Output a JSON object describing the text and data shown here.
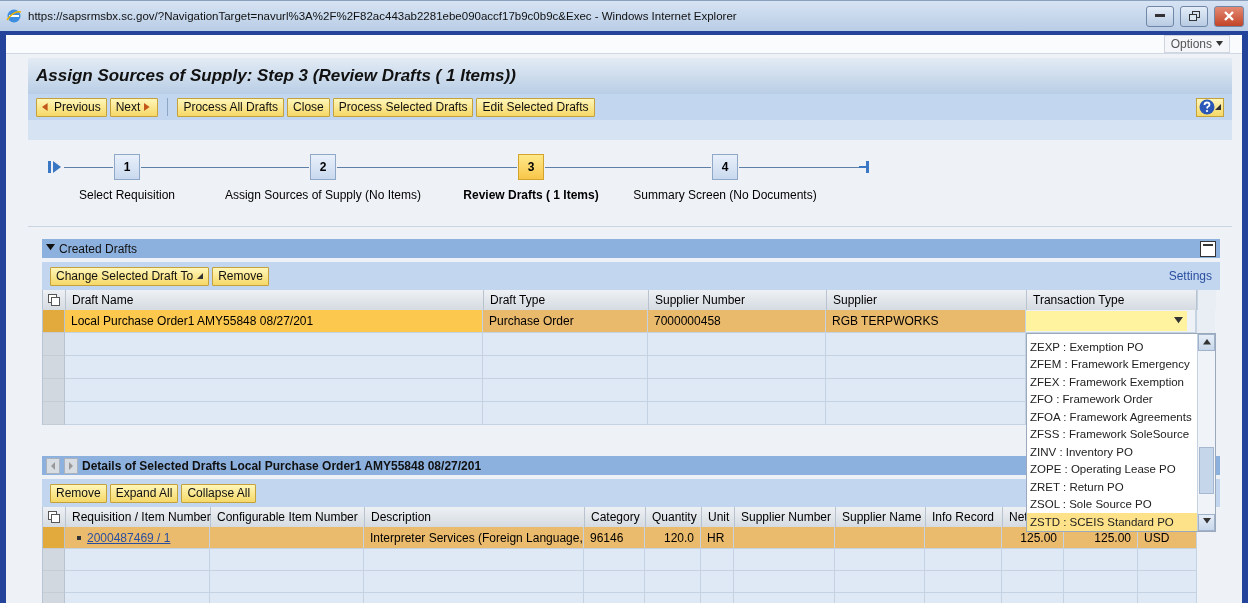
{
  "window": {
    "title": "https://sapsrmsbx.sc.gov/?NavigationTarget=navurl%3A%2F%2F82ac443ab2281ebe090accf17b9c0b9c&Exec - Windows Internet Explorer"
  },
  "options_button": "Options",
  "page": {
    "title": "Assign Sources of Supply: Step 3 (Review Drafts ( 1 Items))",
    "nav_buttons": [
      {
        "label": "Previous",
        "kind": "prev"
      },
      {
        "label": "Next",
        "kind": "next"
      }
    ],
    "toolbar": [
      "Process All Drafts",
      "Close",
      "Process Selected Drafts",
      "Edit Selected Drafts"
    ]
  },
  "roadmap": [
    {
      "number": "1",
      "label": "Select Requisition",
      "selected": false
    },
    {
      "number": "2",
      "label": "Assign Sources of Supply (No Items)",
      "selected": false
    },
    {
      "number": "3",
      "label": "Review Drafts ( 1 Items)",
      "selected": true
    },
    {
      "number": "4",
      "label": "Summary Screen (No Documents)",
      "selected": false
    }
  ],
  "created_drafts": {
    "title": "Created Drafts",
    "expanded": true,
    "toolbar": [
      {
        "label": "Change Selected Draft To",
        "kind": "menu"
      },
      {
        "label": "Remove",
        "kind": "plain"
      }
    ],
    "settings_link": "Settings",
    "columns": {
      "draft_name": "Draft Name",
      "draft_type": "Draft Type",
      "supplier_number": "Supplier Number",
      "supplier": "Supplier",
      "transaction_type": "Transaction Type"
    },
    "rows": [
      {
        "selected": true,
        "draft_name": "Local Purchase Order1 AMY55848 08/27/201",
        "draft_type": "Purchase Order",
        "supplier_number": "7000000458",
        "supplier": "RGB TERPWORKS"
      }
    ],
    "transaction_type_options": [
      {
        "label": "ZEXP : Exemption PO",
        "selected": false
      },
      {
        "label": "ZFEM : Framework Emergency",
        "selected": false
      },
      {
        "label": "ZFEX : Framework Exemption",
        "selected": false
      },
      {
        "label": "ZFO : Framework Order",
        "selected": false
      },
      {
        "label": "ZFOA : Framework Agreements",
        "selected": false
      },
      {
        "label": "ZFSS : Framework SoleSource",
        "selected": false
      },
      {
        "label": "ZINV : Inventory PO",
        "selected": false
      },
      {
        "label": "ZOPE : Operating Lease PO",
        "selected": false
      },
      {
        "label": "ZRET : Return PO",
        "selected": false
      },
      {
        "label": "ZSOL : Sole Source PO",
        "selected": false
      },
      {
        "label": "ZSTD : SCEIS Standard PO",
        "selected": true
      }
    ]
  },
  "details": {
    "title": "Details of Selected Drafts Local Purchase Order1 AMY55848 08/27/201",
    "toolbar": [
      "Remove",
      "Expand All",
      "Collapse All"
    ],
    "columns": {
      "requisition_item": "Requisition / Item Number",
      "configurable_item": "Configurable Item Number",
      "description": "Description",
      "category": "Category",
      "quantity": "Quantity",
      "unit": "Unit",
      "supplier_number": "Supplier Number",
      "supplier_name": "Supplier Name",
      "info_record": "Info Record",
      "net": "Net"
    },
    "rows": [
      {
        "selected": true,
        "requisition_item": "2000487469 / 1",
        "description": "Interpreter Services (Foreign Language,",
        "category": "96146",
        "quantity": "120.0",
        "unit": "HR",
        "net": "125.00",
        "column_12": "125.00",
        "column_13": "USD"
      }
    ]
  }
}
